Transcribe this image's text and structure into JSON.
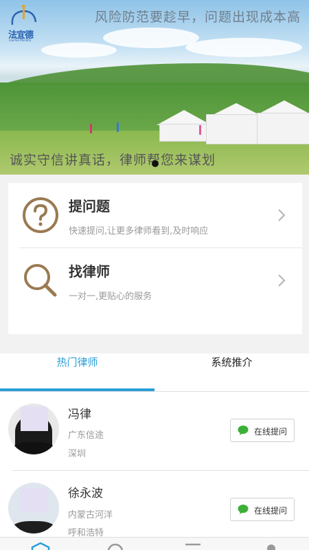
{
  "banner": {
    "logo_text": "法宜德",
    "logo_sub": "LawYue Morality",
    "headline_top": "风险防范要趁早，问题出现成本高",
    "headline_bottom": "诚实守信讲真话，律师帮您来谋划"
  },
  "actions": [
    {
      "title": "提问题",
      "subtitle": "快速提问,让更多律师看到,及时响应",
      "icon": "question-icon"
    },
    {
      "title": "找律师",
      "subtitle": "一对一,更贴心的服务",
      "icon": "search-icon"
    }
  ],
  "tabs": [
    {
      "label": "热门律师",
      "active": true
    },
    {
      "label": "系统推介",
      "active": false
    }
  ],
  "lawyers": [
    {
      "name": "冯律",
      "firm": "广东信途",
      "city": "深圳",
      "button": "在线提问"
    },
    {
      "name": "徐永波",
      "firm": "内蒙古河洋",
      "city": "呼和浩特",
      "button": "在线提问"
    }
  ],
  "colors": {
    "accent": "#2a9fd8",
    "icon_brown": "#9b7a52",
    "wechat_green": "#3bb036"
  }
}
